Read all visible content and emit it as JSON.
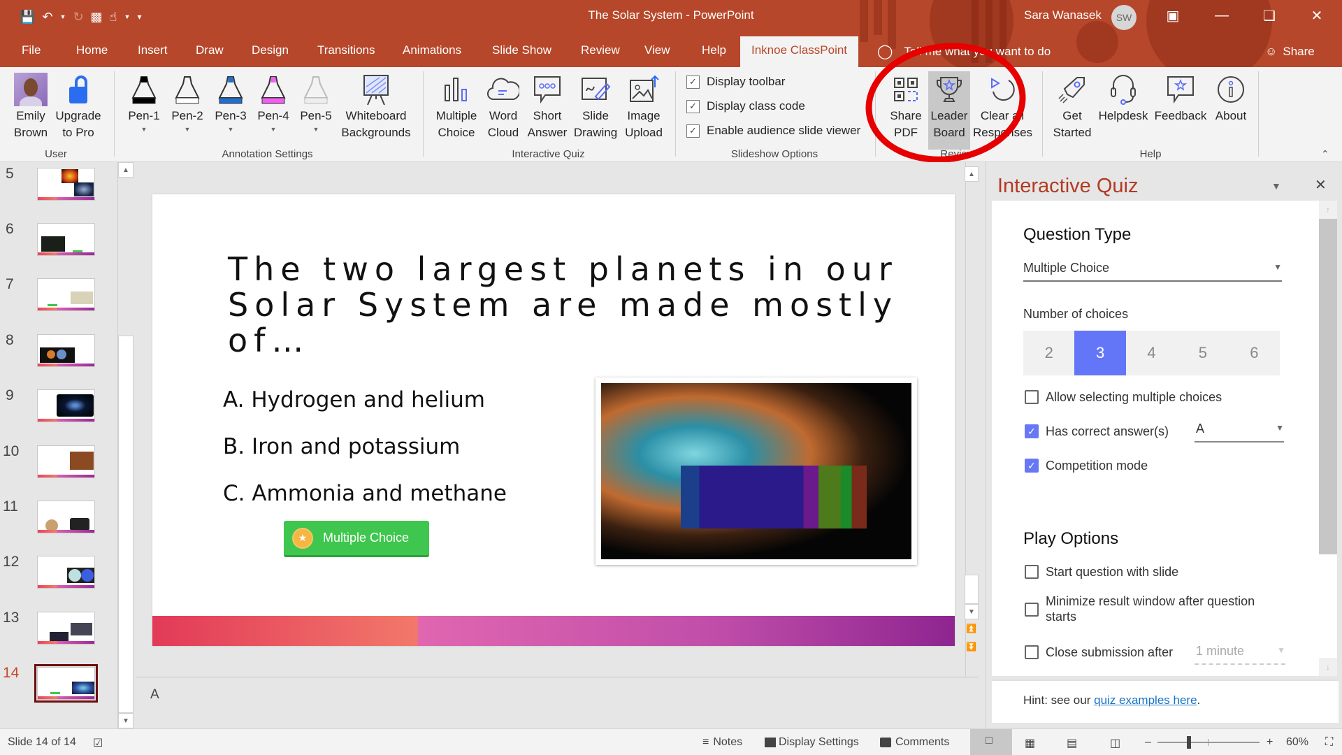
{
  "window": {
    "title": "The Solar System  -  PowerPoint",
    "user_name": "Sara Wanasek",
    "user_initials": "SW"
  },
  "quick_access": [
    "save-icon",
    "undo-icon",
    "redo-icon",
    "present-icon",
    "touch-mode-icon",
    "customize-icon"
  ],
  "tabs": [
    {
      "label": "File"
    },
    {
      "label": "Home"
    },
    {
      "label": "Insert"
    },
    {
      "label": "Draw"
    },
    {
      "label": "Design"
    },
    {
      "label": "Transitions"
    },
    {
      "label": "Animations"
    },
    {
      "label": "Slide Show"
    },
    {
      "label": "Review"
    },
    {
      "label": "View"
    },
    {
      "label": "Help"
    },
    {
      "label": "Inknoe ClassPoint",
      "active": true
    }
  ],
  "tell_me": "Tell me what you want to do",
  "share_label": "Share",
  "ribbon": {
    "user_group": {
      "label": "User",
      "account": "Emily Brown",
      "upgrade": "Upgrade to Pro"
    },
    "annotation_group": {
      "label": "Annotation Settings",
      "pens": [
        {
          "label": "Pen-1",
          "color": "#000000"
        },
        {
          "label": "Pen-2",
          "color": "#ffffff"
        },
        {
          "label": "Pen-3",
          "color": "#1f6fd0"
        },
        {
          "label": "Pen-4",
          "color": "#f25ef0"
        },
        {
          "label": "Pen-5",
          "color": "#e8e8e8"
        }
      ],
      "whiteboard": "Whiteboard Backgrounds"
    },
    "quiz_group": {
      "label": "Interactive Quiz",
      "items": [
        "Multiple Choice",
        "Word Cloud",
        "Short Answer",
        "Slide Drawing",
        "Image Upload"
      ]
    },
    "slideshow_group": {
      "label": "Slideshow Options",
      "options": [
        {
          "label": "Display toolbar",
          "checked": true
        },
        {
          "label": "Display class code",
          "checked": true
        },
        {
          "label": "Enable audience slide viewer",
          "checked": true
        }
      ]
    },
    "review_group": {
      "label": "Review",
      "items": [
        "Share PDF",
        "Leader Board",
        "Clear all Responses"
      ]
    },
    "help_group": {
      "label": "Help",
      "items": [
        "Get Started",
        "Helpdesk",
        "Feedback",
        "About"
      ]
    }
  },
  "thumbnails": [
    {
      "number": "5"
    },
    {
      "number": "6"
    },
    {
      "number": "7"
    },
    {
      "number": "8"
    },
    {
      "number": "9"
    },
    {
      "number": "10"
    },
    {
      "number": "11"
    },
    {
      "number": "12"
    },
    {
      "number": "13"
    },
    {
      "number": "14",
      "active": true
    }
  ],
  "slide": {
    "title": "The two largest planets in our Solar System are made mostly of…",
    "answers": [
      "A. Hydrogen and helium",
      "B. Iron and potassium",
      "C. Ammonia and methane"
    ],
    "badge": "Multiple Choice",
    "image_alt": "Crab nebula with periodic table overlay"
  },
  "notes": "A",
  "pane": {
    "title": "Interactive Quiz",
    "question_type_heading": "Question Type",
    "question_type_value": "Multiple Choice",
    "num_choices_label": "Number of choices",
    "choices": [
      "2",
      "3",
      "4",
      "5",
      "6"
    ],
    "selected_choice": "3",
    "options": [
      {
        "label": "Allow selecting multiple choices",
        "checked": false
      },
      {
        "label": "Has correct answer(s)",
        "checked": true,
        "value": "A"
      },
      {
        "label": "Competition mode",
        "checked": true
      }
    ],
    "play_heading": "Play Options",
    "play_options": [
      {
        "label": "Start question with slide",
        "checked": false
      },
      {
        "label": "Minimize result window after question starts",
        "checked": false
      },
      {
        "label": "Close submission after",
        "checked": false,
        "value": "1 minute"
      }
    ],
    "hint_prefix": "Hint: see our ",
    "hint_link": "quiz examples here",
    "hint_suffix": "."
  },
  "status": {
    "slide_counter": "Slide 14 of 14",
    "notes": "Notes",
    "display_settings": "Display Settings",
    "comments": "Comments",
    "zoom": "60%"
  },
  "colors": {
    "accent": "#b7472a",
    "classpoint_blue": "#6476f8",
    "badge_green": "#3fc64e",
    "annotation_red": "#e60000"
  }
}
